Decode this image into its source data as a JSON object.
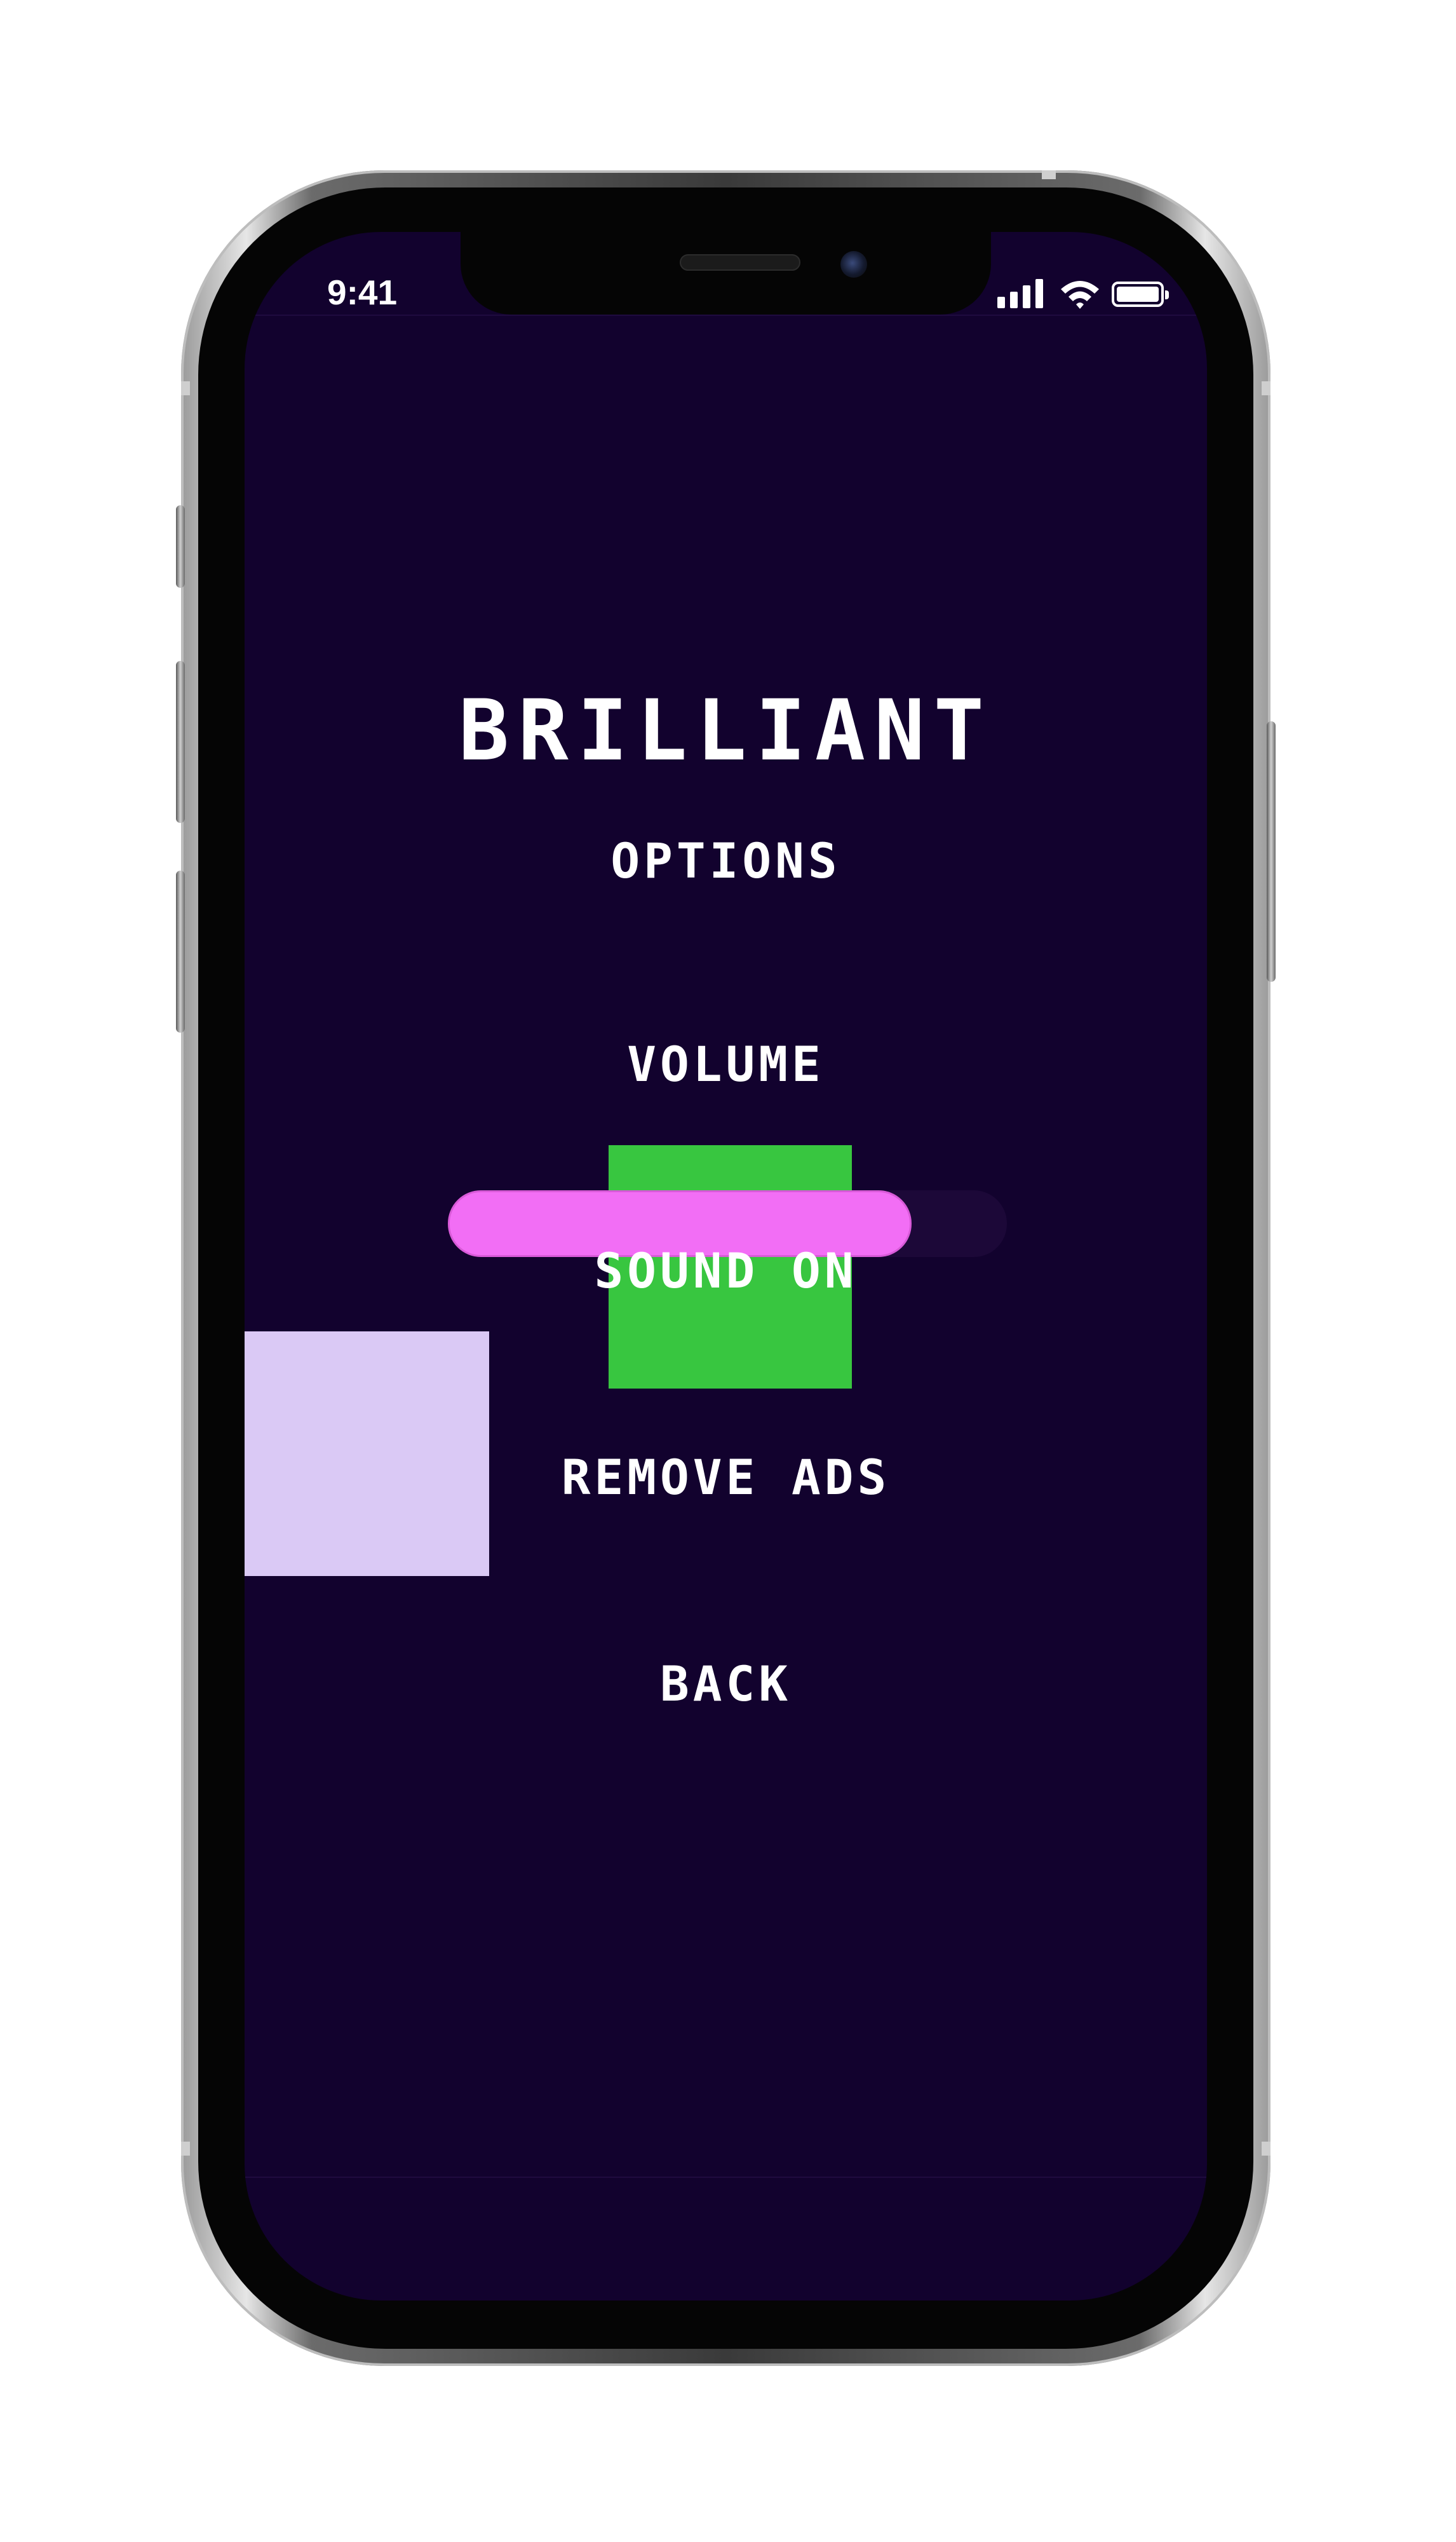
{
  "status_bar": {
    "time": "9:41",
    "signal_icon": "cellular-signal-icon",
    "wifi_icon": "wifi-icon",
    "battery_icon": "battery-icon"
  },
  "game": {
    "title": "BRILLIANT",
    "menu": {
      "options_label": "OPTIONS",
      "volume_label": "VOLUME",
      "sound_label": "SOUND ON",
      "remove_ads_label": "REMOVE ADS",
      "back_label": "BACK"
    },
    "volume_slider": {
      "level_fraction": 0.83
    }
  },
  "colors": {
    "screen_background": "#12022e",
    "text": "#ffffff",
    "slider_fill": "#f26ef5",
    "green_block": "#38c640",
    "lilac_block": "#dac9f5"
  }
}
